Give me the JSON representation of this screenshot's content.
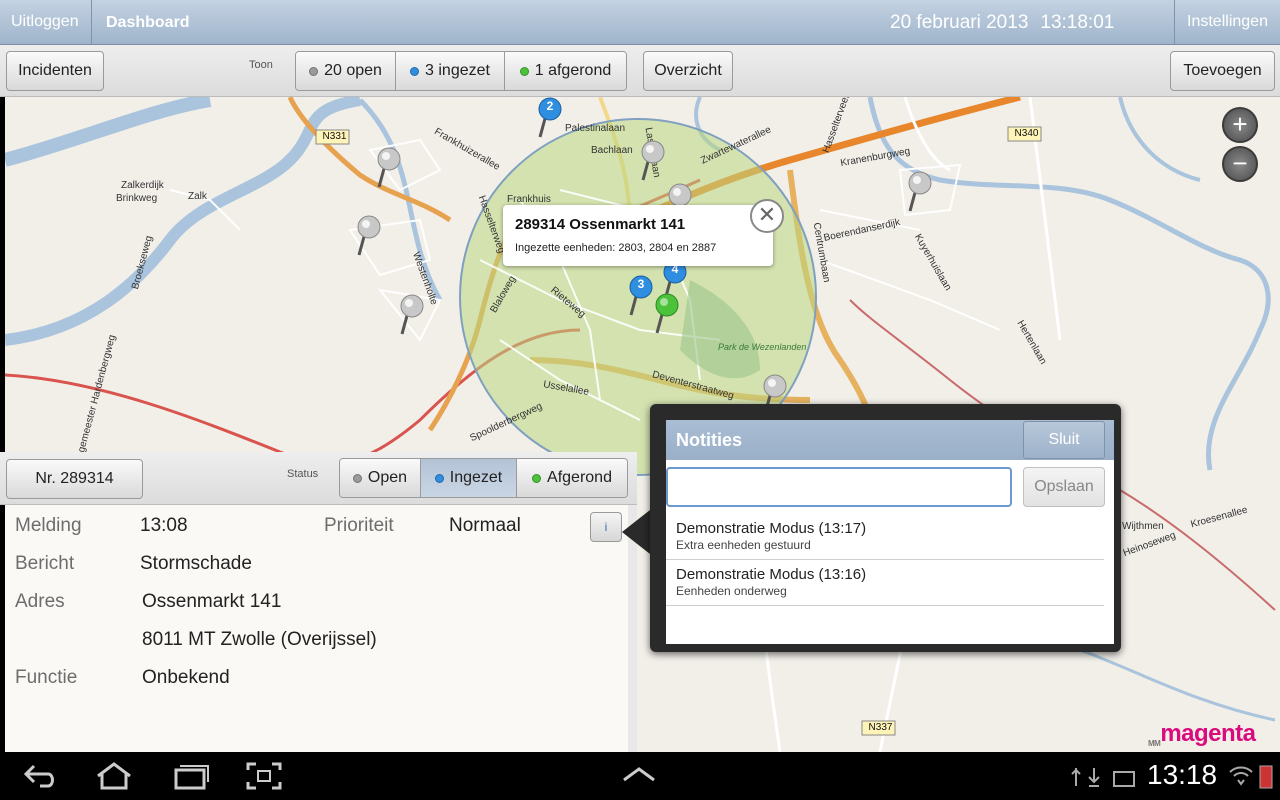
{
  "header": {
    "logout_label": "Uitloggen",
    "title": "Dashboard",
    "date": "20 februari 2013",
    "time": "13:18:01",
    "settings_label": "Instellingen"
  },
  "toolbar": {
    "incidents_label": "Incidenten",
    "toon_label": "Toon",
    "filters": [
      {
        "label": "20 open",
        "color": "grey"
      },
      {
        "label": "3 ingezet",
        "color": "blue"
      },
      {
        "label": "1 afgerond",
        "color": "green"
      }
    ],
    "overview_label": "Overzicht",
    "add_label": "Toevoegen"
  },
  "map": {
    "road_labels": [
      "N331",
      "N340",
      "N337"
    ],
    "street_labels": [
      "Zalkerdijk",
      "Zalk",
      "Brinkweg",
      "Frankhuizerallee",
      "Palestinalaan",
      "Bachlaan",
      "Lassuslaan",
      "Zwartewaterallee",
      "Frankhuis",
      "Hasselterweg",
      "Westenholte",
      "Blaloweg",
      "Rieteweg",
      "Usselallee",
      "Spoolderbergweg",
      "Deventerstraatweg",
      "Park de Wezenlanden",
      "Centrumbaan",
      "Boerendanserdijk",
      "Kranenburgweg",
      "Kuyerhuislaan",
      "Hertenlaan",
      "Broekseweg",
      "Hoogemeester Hardenbergweg",
      "Hasselterveen",
      "Kroesenallee",
      "Wijthmen",
      "Heinoseweg"
    ],
    "pin_labels": [
      "2",
      "3",
      "4"
    ],
    "zoom_in": "+",
    "zoom_out": "−",
    "popup": {
      "title": "289314 Ossenmarkt 141",
      "subtitle": "Ingezette eenheden: 2803, 2804 en 2887",
      "close": "✕"
    }
  },
  "detail": {
    "number_label": "Nr. 289314",
    "status_label": "Status",
    "status_options": [
      {
        "label": "Open",
        "color": "grey"
      },
      {
        "label": "Ingezet",
        "color": "blue",
        "active": true
      },
      {
        "label": "Afgerond",
        "color": "green"
      }
    ],
    "melding_label": "Melding",
    "melding_value": "13:08",
    "prioriteit_label": "Prioriteit",
    "prioriteit_value": "Normaal",
    "bericht_label": "Bericht",
    "bericht_value": "Stormschade",
    "adres_label": "Adres",
    "adres_line1": "Ossenmarkt 141",
    "adres_line2": "8011 MT Zwolle (Overijssel)",
    "functie_label": "Functie",
    "functie_value": "Onbekend",
    "info_icon": "i"
  },
  "notes": {
    "title": "Notities",
    "close_label": "Sluit",
    "input_value": "",
    "save_label": "Opslaan",
    "items": [
      {
        "title": "Demonstratie Modus (13:17)",
        "sub": "Extra eenheden gestuurd"
      },
      {
        "title": "Demonstratie Modus (13:16)",
        "sub": "Eenheden onderweg"
      }
    ]
  },
  "branding": {
    "logo_main": "magenta",
    "logo_sub": "MM"
  },
  "system_bar": {
    "clock": "13:18"
  }
}
